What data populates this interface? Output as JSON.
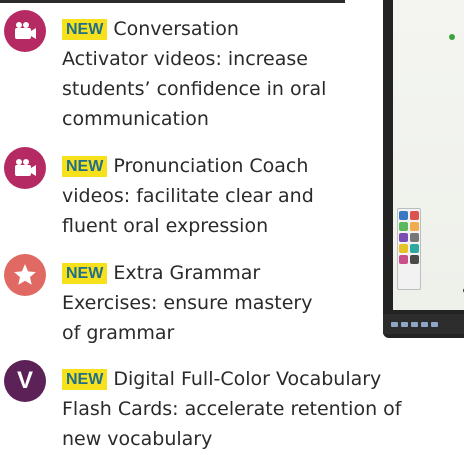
{
  "features": [
    {
      "badge": "NEW",
      "icon": "video-camera-icon",
      "lines": [
        "Conversation",
        "Activator videos: increase",
        "students’ confidence in oral",
        "communication"
      ]
    },
    {
      "badge": "NEW",
      "icon": "video-camera-icon",
      "lines": [
        "Pronunciation Coach",
        "videos: facilitate clear and",
        "fluent oral expression"
      ]
    },
    {
      "badge": "NEW",
      "icon": "star-icon",
      "lines": [
        "Extra Grammar",
        "Exercises: ensure mastery",
        "of grammar"
      ]
    },
    {
      "badge": "NEW",
      "icon": "letter-v-icon",
      "icon_letter": "V",
      "lines": [
        "Digital Full-Color Vocabulary",
        "Flash Cards: accelerate retention of",
        "new vocabulary"
      ]
    }
  ],
  "colors": {
    "icon_magenta": "#b52a63",
    "icon_red": "#e06a63",
    "icon_purple": "#5c2258",
    "badge_yellow": "#f7e11c",
    "badge_text": "#1f6f8a"
  }
}
